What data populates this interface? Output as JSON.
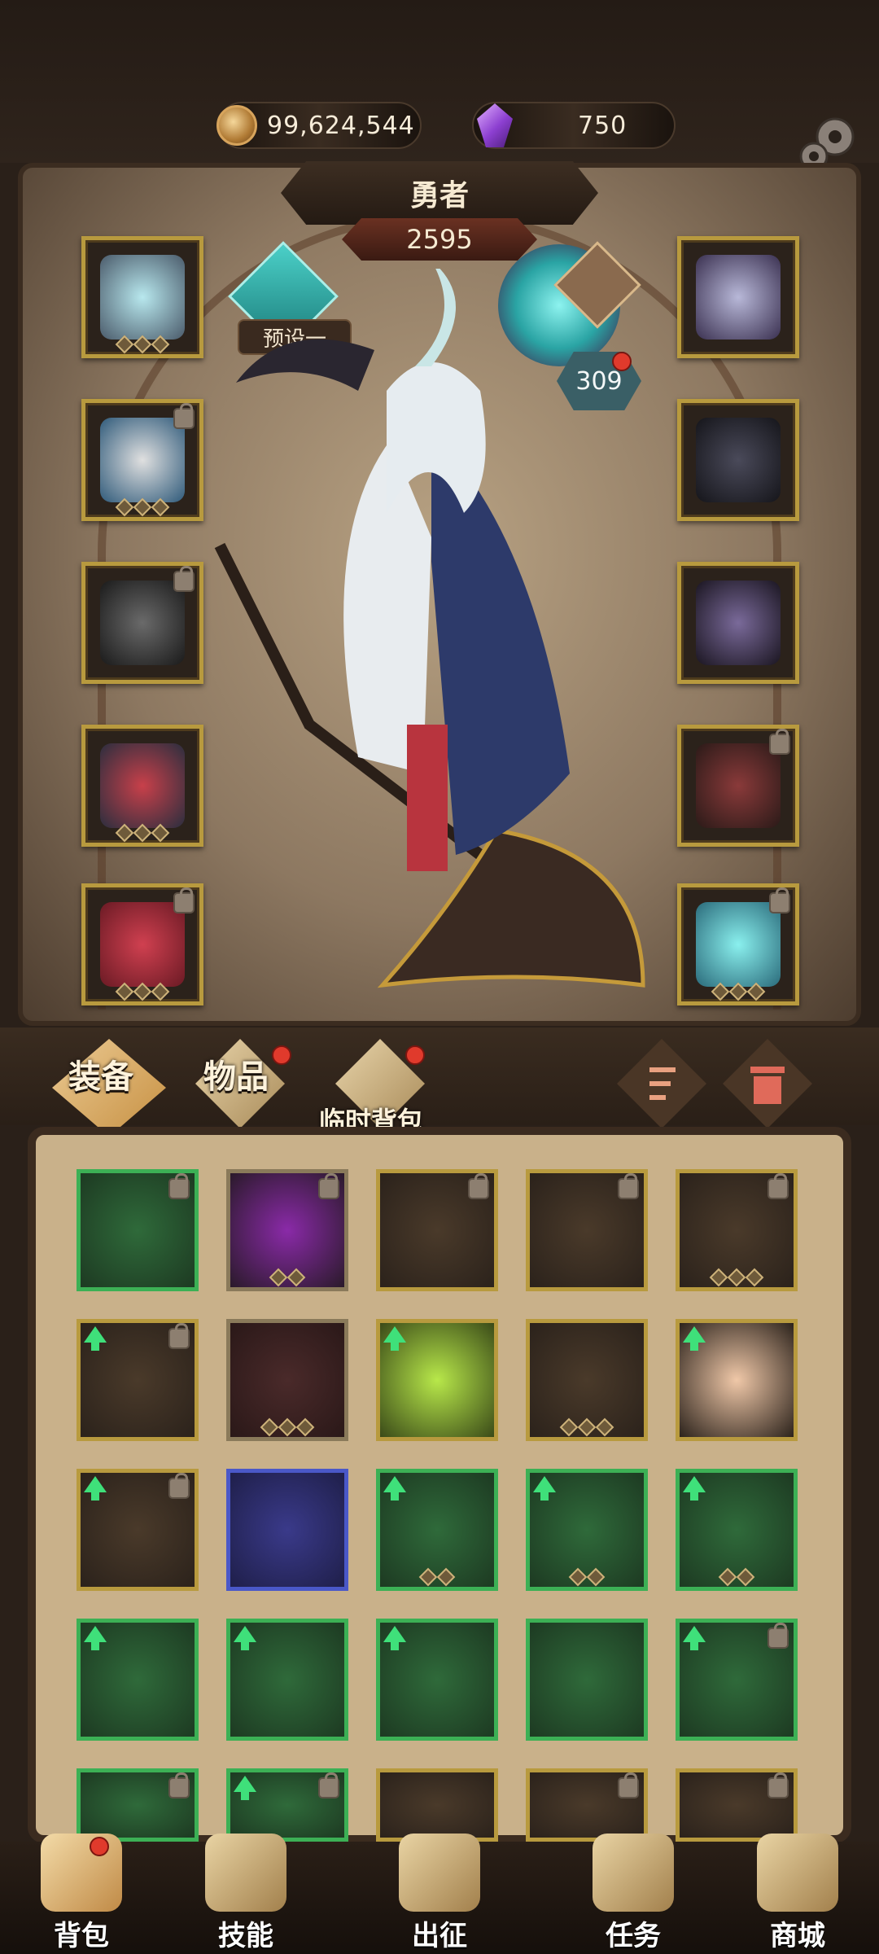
{
  "currency": {
    "coins": "99,624,544",
    "gems": "750"
  },
  "hero": {
    "title": "勇者",
    "power": "2595",
    "preset_label": "预设一",
    "pet_level": "309"
  },
  "tabs": {
    "equipment": "装备",
    "items": "物品",
    "temp_bag": "临时背包"
  },
  "nav": {
    "bag": "背包",
    "skills": "技能",
    "expedition": "出征",
    "quests": "任务",
    "shop": "商城"
  },
  "colors": {
    "accent_gold": "#b89a3e",
    "rarity_green": "#3cb055",
    "rarity_blue": "#4a58c8",
    "notify_red": "#e03a2c"
  }
}
